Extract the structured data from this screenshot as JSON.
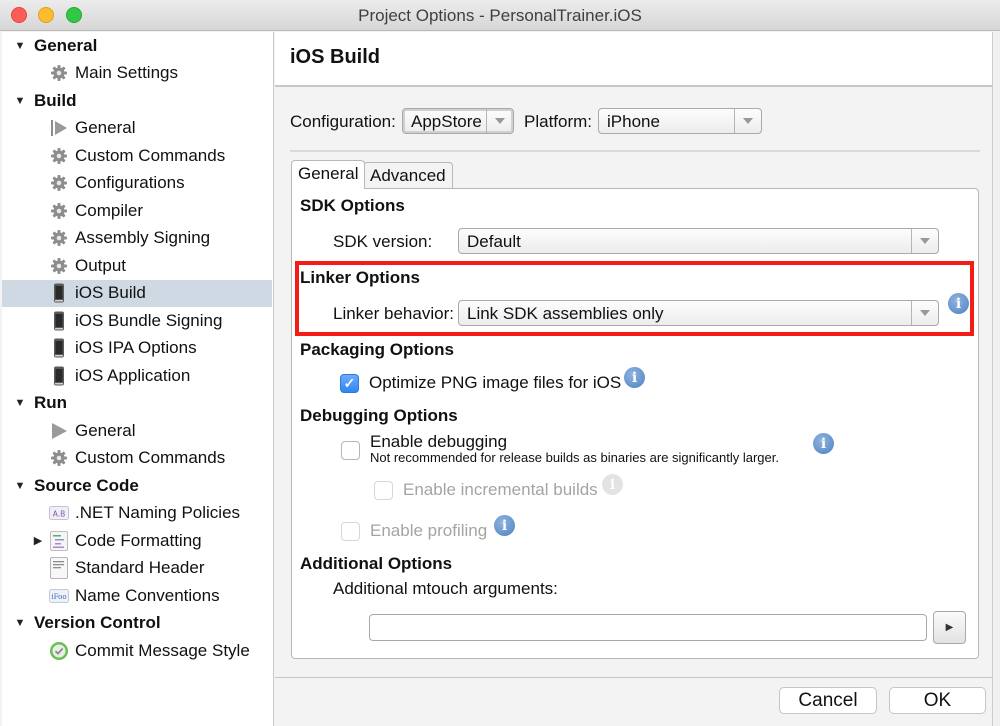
{
  "window": {
    "title": "Project Options - PersonalTrainer.iOS",
    "colors": {
      "highlight_box": "#f41d15",
      "selection": "#cfd9e4",
      "checkbox_accent": "#2f86f4",
      "info_icon": "#4d82c2"
    }
  },
  "sidebar": {
    "rows": [
      {
        "type": "category",
        "label": "General",
        "expanded": true
      },
      {
        "type": "item",
        "label": "Main Settings",
        "icon": "gear-icon"
      },
      {
        "type": "category",
        "label": "Build",
        "expanded": true
      },
      {
        "type": "item",
        "label": "General",
        "icon": "build-play-icon"
      },
      {
        "type": "item",
        "label": "Custom Commands",
        "icon": "gear-icon"
      },
      {
        "type": "item",
        "label": "Configurations",
        "icon": "gear-icon"
      },
      {
        "type": "item",
        "label": "Compiler",
        "icon": "gear-icon"
      },
      {
        "type": "item",
        "label": "Assembly Signing",
        "icon": "gear-icon"
      },
      {
        "type": "item",
        "label": "Output",
        "icon": "gear-icon"
      },
      {
        "type": "item",
        "label": "iOS Build",
        "icon": "iphone-icon",
        "selected": true
      },
      {
        "type": "item",
        "label": "iOS Bundle Signing",
        "icon": "iphone-icon"
      },
      {
        "type": "item",
        "label": "iOS IPA Options",
        "icon": "iphone-icon"
      },
      {
        "type": "item",
        "label": "iOS Application",
        "icon": "iphone-icon"
      },
      {
        "type": "category",
        "label": "Run",
        "expanded": true
      },
      {
        "type": "item",
        "label": "General",
        "icon": "play-icon"
      },
      {
        "type": "item",
        "label": "Custom Commands",
        "icon": "gear-icon"
      },
      {
        "type": "category",
        "label": "Source Code",
        "expanded": true
      },
      {
        "type": "item",
        "label": ".NET Naming Policies",
        "icon": "naming-policy-icon",
        "icon_text": "A.B"
      },
      {
        "type": "item",
        "label": "Code Formatting",
        "icon": "code-formatting-icon",
        "collapsed_arrow": true
      },
      {
        "type": "item",
        "label": "Standard Header",
        "icon": "document-icon"
      },
      {
        "type": "item",
        "label": "Name Conventions",
        "icon": "name-conventions-icon",
        "icon_text": "iFoo"
      },
      {
        "type": "category",
        "label": "Version Control",
        "expanded": true
      },
      {
        "type": "item",
        "label": "Commit Message Style",
        "icon": "commit-check-icon"
      }
    ]
  },
  "main": {
    "header": "iOS Build",
    "configuration_label": "Configuration:",
    "configuration_value": "AppStore",
    "platform_label": "Platform:",
    "platform_value": "iPhone",
    "tabs": [
      {
        "label": "General",
        "active": true
      },
      {
        "label": "Advanced",
        "active": false
      }
    ],
    "sdk": {
      "heading": "SDK Options",
      "version_label": "SDK version:",
      "version_value": "Default"
    },
    "linker": {
      "heading": "Linker Options",
      "behavior_label": "Linker behavior:",
      "behavior_value": "Link SDK assemblies only"
    },
    "packaging": {
      "heading": "Packaging Options",
      "optimize_png_label": "Optimize PNG image files for iOS",
      "optimize_png_checked": true
    },
    "debugging": {
      "heading": "Debugging Options",
      "enable_debugging_label": "Enable debugging",
      "enable_debugging_note": "Not recommended for release builds as binaries are significantly larger.",
      "enable_debugging_checked": false,
      "incremental_label": "Enable incremental builds",
      "incremental_checked": false,
      "incremental_enabled": false,
      "profiling_label": "Enable profiling",
      "profiling_checked": false,
      "profiling_enabled": false
    },
    "additional": {
      "heading": "Additional Options",
      "mtouch_label": "Additional mtouch arguments:",
      "mtouch_value": "",
      "run_button_glyph": "▶"
    }
  },
  "footer": {
    "cancel_label": "Cancel",
    "ok_label": "OK"
  },
  "glyphs": {
    "expanded_arrow": "▼",
    "collapsed_arrow": "▶",
    "info": "i",
    "check": "✓"
  }
}
